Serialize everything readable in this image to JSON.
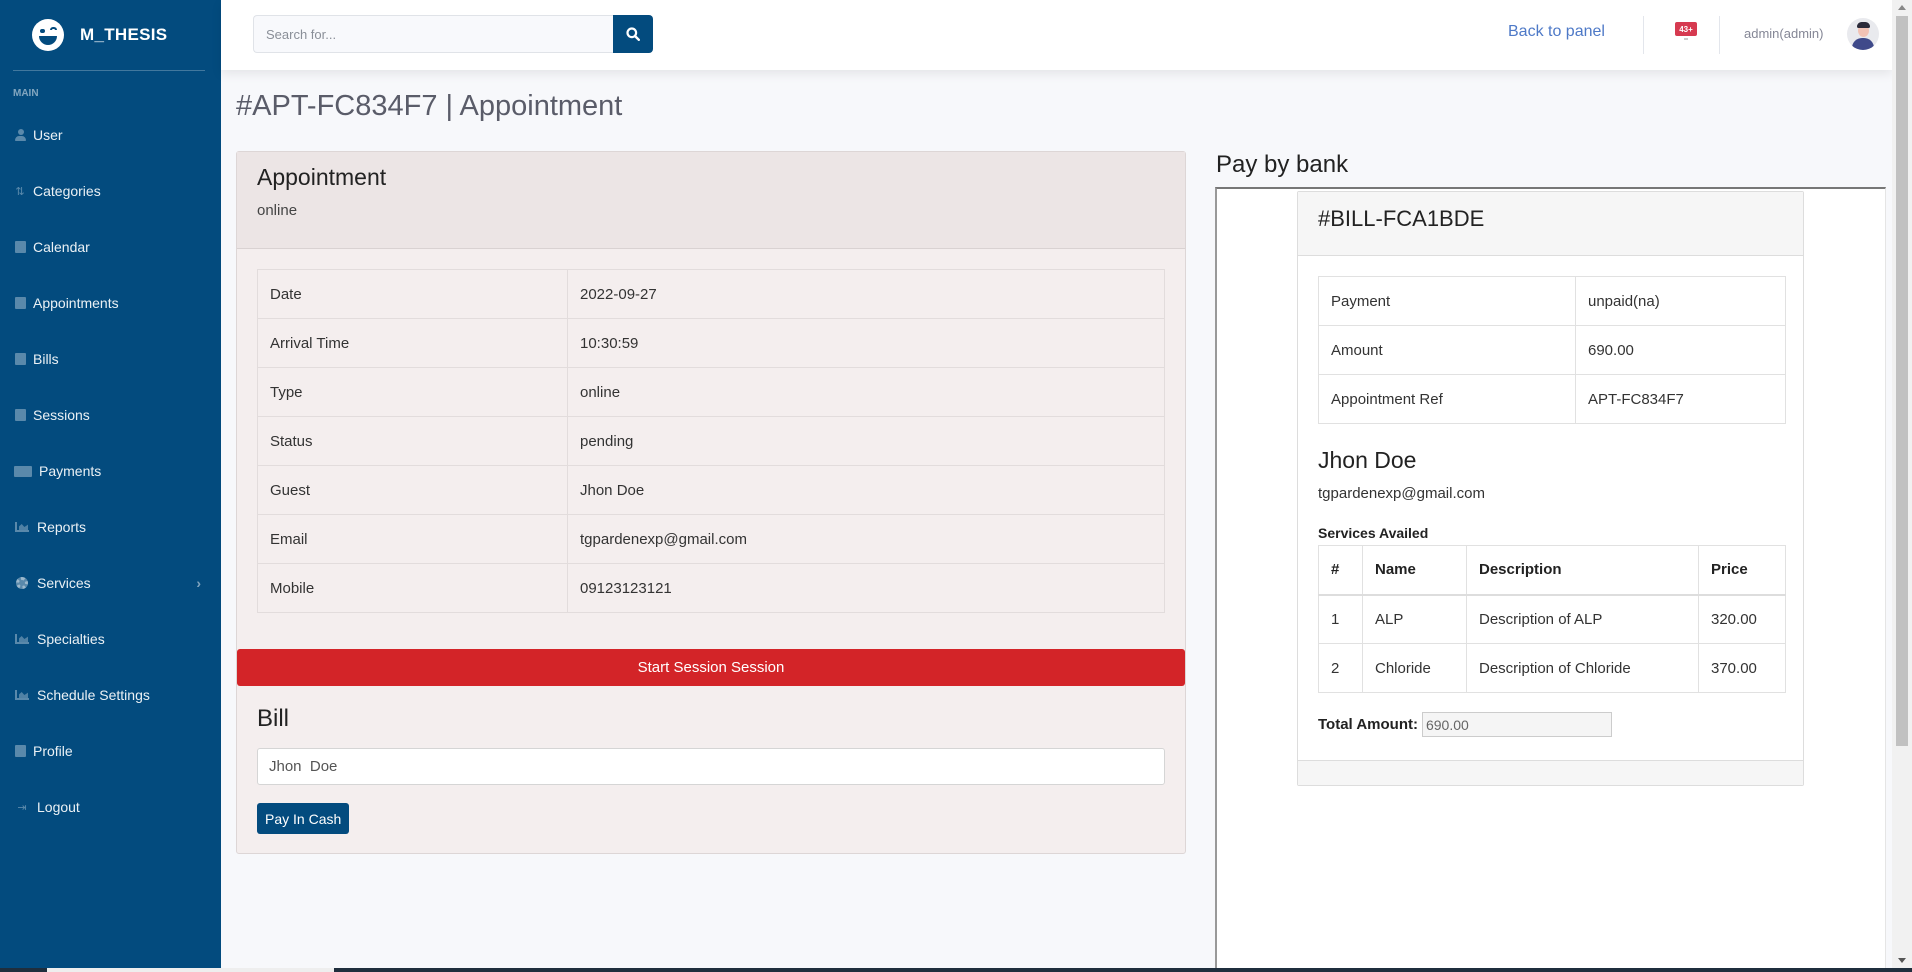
{
  "brand": {
    "name": "M_THESIS",
    "logo_icon": "winking-face-icon"
  },
  "sidebar": {
    "heading": "MAIN",
    "items": [
      {
        "label": "User",
        "icon": "user-icon"
      },
      {
        "label": "Categories",
        "icon": "sort-numeric-icon"
      },
      {
        "label": "Calendar",
        "icon": "calendar-icon"
      },
      {
        "label": "Appointments",
        "icon": "calendar-check-icon"
      },
      {
        "label": "Bills",
        "icon": "file-icon"
      },
      {
        "label": "Sessions",
        "icon": "calendar-check-icon"
      },
      {
        "label": "Payments",
        "icon": "credit-card-icon"
      },
      {
        "label": "Reports",
        "icon": "chart-area-icon"
      },
      {
        "label": "Services",
        "icon": "gear-icon",
        "has_submenu": true
      },
      {
        "label": "Specialties",
        "icon": "chart-area-icon"
      },
      {
        "label": "Schedule Settings",
        "icon": "chart-area-icon"
      },
      {
        "label": "Profile",
        "icon": "calendar-check-icon"
      },
      {
        "label": "Logout",
        "icon": "sign-out-icon"
      }
    ]
  },
  "topbar": {
    "search_placeholder": "Search for...",
    "search_value": "",
    "back_link": "Back to panel",
    "alert_badge": "43+",
    "user_name": "admin(admin)"
  },
  "page": {
    "title": "#APT-FC834F7 | Appointment"
  },
  "appointment": {
    "header_title": "Appointment",
    "header_sub": "online",
    "rows": [
      {
        "label": "Date",
        "value": "2022-09-27"
      },
      {
        "label": "Arrival Time",
        "value": "10:30:59"
      },
      {
        "label": "Type",
        "value": "online"
      },
      {
        "label": "Status",
        "value": "pending"
      },
      {
        "label": "Guest",
        "value": "Jhon Doe"
      },
      {
        "label": "Email",
        "value": "tgpardenexp@gmail.com"
      },
      {
        "label": "Mobile",
        "value": "09123123121"
      }
    ],
    "start_button": "Start Session Session",
    "bill_title": "Bill",
    "bill_input_value": "Jhon  Doe",
    "pay_cash_button": "Pay In Cash"
  },
  "bank": {
    "title": "Pay by bank",
    "bill_id": "#BILL-FCA1BDE",
    "summary": [
      {
        "label": "Payment",
        "value": "unpaid(na)",
        "green": false
      },
      {
        "label": "Amount",
        "value": "690.00",
        "green": true
      },
      {
        "label": "Appointment Ref",
        "value": "APT-FC834F7",
        "green": false
      }
    ],
    "customer_name": "Jhon Doe",
    "customer_email": "tgpardenexp@gmail.com",
    "services_label": "Services Availed",
    "services_headers": [
      "#",
      "Name",
      "Description",
      "Price"
    ],
    "services": [
      {
        "no": "1",
        "name": "ALP",
        "description": "Description of ALP",
        "price": "320.00"
      },
      {
        "no": "2",
        "name": "Chloride",
        "description": "Description of Chloride",
        "price": "370.00"
      }
    ],
    "total_label": "Total Amount:",
    "total_value": "690.00"
  },
  "colors": {
    "brand_primary": "#034b7e",
    "danger": "#d32428",
    "price_green": "#2b7a2b",
    "link_blue": "#4e79c7"
  }
}
